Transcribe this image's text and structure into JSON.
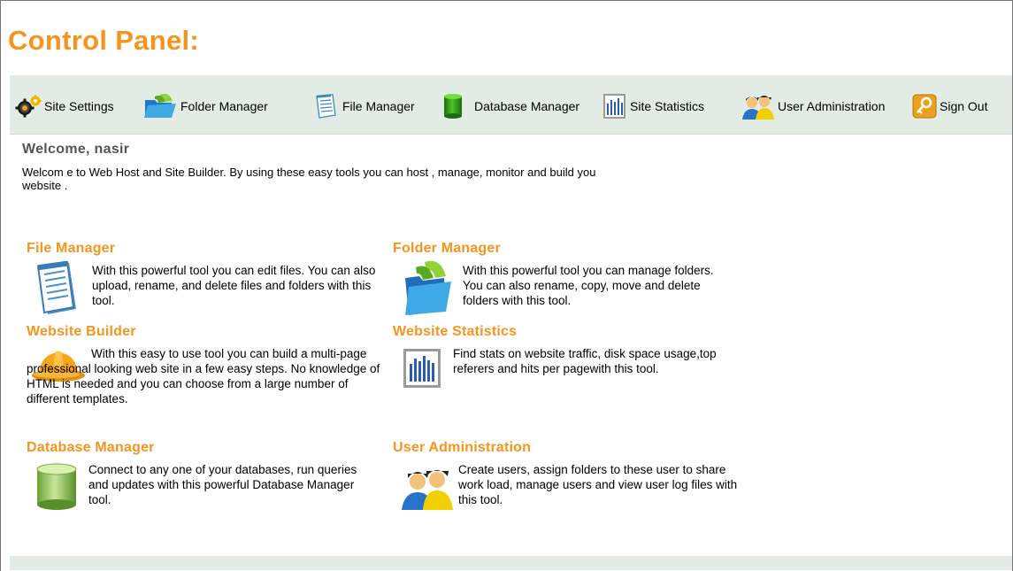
{
  "page": {
    "title": "Control Panel:"
  },
  "toolbar": {
    "items": [
      {
        "label": "Site Settings",
        "icon": "gears-icon"
      },
      {
        "label": "Folder Manager",
        "icon": "folder-icon"
      },
      {
        "label": "File Manager",
        "icon": "document-icon"
      },
      {
        "label": "Database Manager",
        "icon": "database-icon"
      },
      {
        "label": "Site Statistics",
        "icon": "bar-chart-icon"
      },
      {
        "label": "User Administration",
        "icon": "users-icon"
      },
      {
        "label": "Sign Out",
        "icon": "key-icon"
      }
    ]
  },
  "welcome": {
    "heading": "Welcome, nasir",
    "text": "Welcom e to Web Host and Site Builder. By using these easy tools you can host , manage, monitor and  build you website ."
  },
  "sections": {
    "file_manager": {
      "title": "File Manager",
      "text": "With this powerful tool you can edit files. You can also upload, rename, and delete files and folders with this tool.",
      "icon": "document-icon"
    },
    "folder_manager": {
      "title": "Folder Manager",
      "text": "With this powerful tool you can manage folders. You can also rename, copy, move and delete folders with this tool.",
      "icon": "folder-icon"
    },
    "website_builder": {
      "title": "Website Builder",
      "text": "With this easy to use tool you can build a multi-page professional looking web site in a few easy steps. No knowledge of HTML is needed and you can choose from a large number of different templates.",
      "icon": "hardhat-icon"
    },
    "website_statistics": {
      "title": "Website Statistics",
      "text": "Find stats on website traffic, disk space usage,top referers and hits per pagewith this tool.",
      "icon": "bar-chart-icon"
    },
    "database_manager": {
      "title": "Database Manager",
      "text": "Connect to any one of your databases, run queries and updates with this powerful Database Manager tool.",
      "icon": "database-icon"
    },
    "user_administration": {
      "title": "User Administration",
      "text": "Create users, assign folders to these user to share work load, manage users and view user log files with this tool.",
      "icon": "users-icon"
    }
  },
  "colors": {
    "accent": "#f7941d",
    "toolbar_bg": "#e3ebe5",
    "heading_gray": "#555555"
  }
}
